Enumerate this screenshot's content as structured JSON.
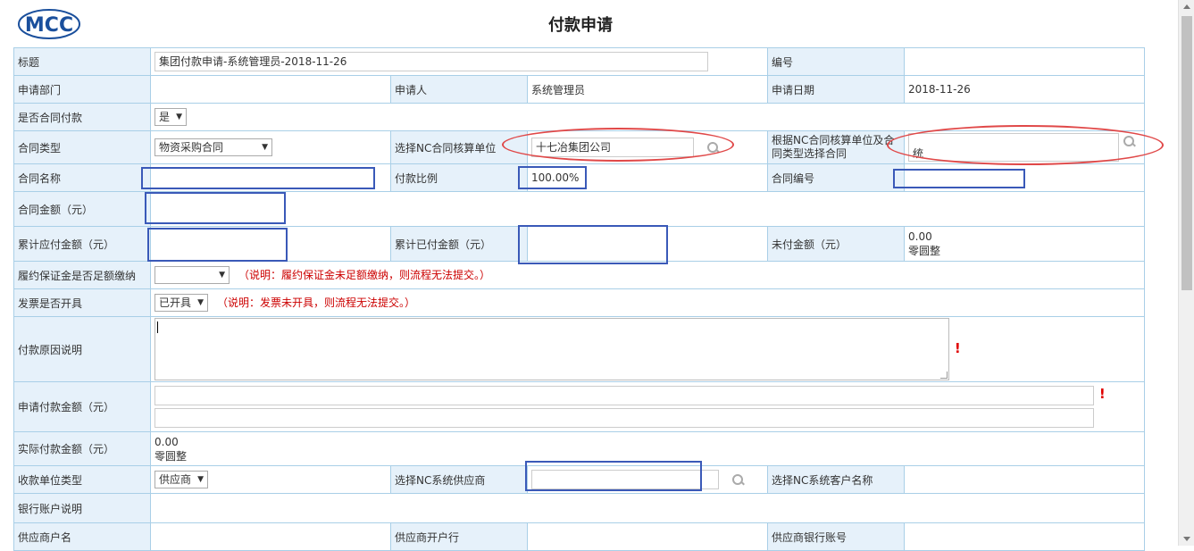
{
  "header": {
    "logo_text": "MCC",
    "title": "付款申请"
  },
  "rows": {
    "title_label": "标题",
    "title_value": "集团付款申请-系统管理员-2018-11-26",
    "number_label": "编号",
    "dept_label": "申请部门",
    "applicant_label": "申请人",
    "applicant_value": "系统管理员",
    "date_label": "申请日期",
    "date_value": "2018-11-26",
    "is_contract_label": "是否合同付款",
    "is_contract_value": "是",
    "contract_type_label": "合同类型",
    "contract_type_value": "物资采购合同",
    "select_nc_unit_label": "选择NC合同核算单位",
    "select_nc_unit_value": "十七冶集团公司",
    "select_contract_label": "根据NC合同核算单位及合同类型选择合同",
    "select_contract_value": "统",
    "contract_name_label": "合同名称",
    "pay_ratio_label": "付款比例",
    "pay_ratio_value": "100.00%",
    "contract_no_label": "合同编号",
    "contract_amount_label": "合同金额（元）",
    "cum_payable_label": "累计应付金额（元）",
    "cum_paid_label": "累计已付金额（元）",
    "unpaid_label": "未付金额（元）",
    "unpaid_value": "0.00",
    "unpaid_words": "零圆整",
    "deposit_label": "履约保证金是否足额缴纳",
    "deposit_note": "（说明：履约保证金未足额缴纳，则流程无法提交。）",
    "invoice_label": "发票是否开具",
    "invoice_value": "已开具",
    "invoice_note": "（说明：发票未开具，则流程无法提交。）",
    "reason_label": "付款原因说明",
    "apply_amount_label": "申请付款金额（元）",
    "actual_amount_label": "实际付款金额（元）",
    "actual_amount_value": "0.00",
    "actual_amount_words": "零圆整",
    "payee_type_label": "收款单位类型",
    "payee_type_value": "供应商",
    "select_supplier_label": "选择NC系统供应商",
    "select_customer_label": "选择NC系统客户名称",
    "bank_desc_label": "银行账户说明",
    "supplier_account_name_label": "供应商户名",
    "supplier_bank_label": "供应商开户行",
    "supplier_account_no_label": "供应商银行账号"
  },
  "colors": {
    "label_bg": "#e6f1fa",
    "border": "#a9cfe7",
    "annotation_blue": "#3a59b8",
    "annotation_red": "#e04848"
  }
}
